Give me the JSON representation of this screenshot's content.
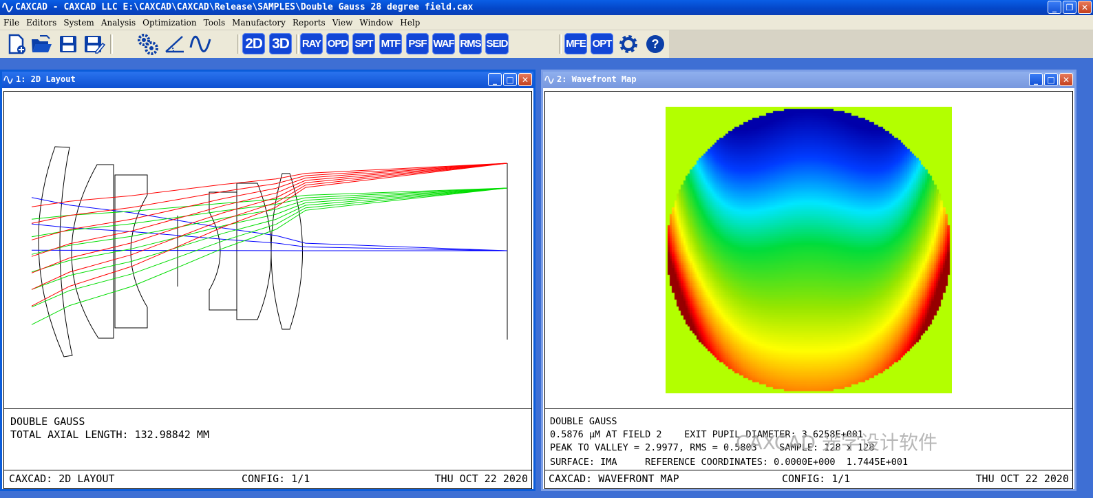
{
  "app": {
    "title": "CAXCAD - CAXCAD LLC E:\\CAXCAD\\CAXCAD\\Release\\SAMPLES\\Double Gauss 28 degree field.cax"
  },
  "menu": [
    "File",
    "Editors",
    "System",
    "Analysis",
    "Optimization",
    "Tools",
    "Manufactory",
    "Reports",
    "View",
    "Window",
    "Help"
  ],
  "toolbar": {
    "file_icons": [
      "new-file-icon",
      "open-folder-icon",
      "save-icon",
      "save-as-icon"
    ],
    "tool_icons": [
      "system-gears-icon",
      "angle-icon",
      "wave-icon"
    ],
    "view_buttons": [
      "2D",
      "3D"
    ],
    "analysis_buttons": [
      "RAY",
      "OPD",
      "SPT",
      "MTF",
      "PSF",
      "WAF",
      "RMS",
      "SEID"
    ],
    "opt_buttons": [
      "MFE",
      "OPT"
    ],
    "extra_icons": [
      "settings-gear-icon",
      "help-icon"
    ]
  },
  "window1": {
    "title": "1: 2D Layout",
    "line1": "DOUBLE GAUSS",
    "line2": "TOTAL AXIAL LENGTH: 132.98842 MM",
    "status_left": "CAXCAD: 2D LAYOUT",
    "status_mid": "CONFIG: 1/1",
    "status_right": "THU OCT 22 2020",
    "ray_colors": [
      "#0000ff",
      "#00dd00",
      "#ff0000"
    ]
  },
  "window2": {
    "title": "2: Wavefront Map",
    "line1": "DOUBLE GAUSS",
    "line2": "0.5876 µM AT FIELD 2    EXIT PUPIL DIAMETER: 3.6258E+001",
    "line3": "PEAK TO VALLEY = 2.9977, RMS = 0.5803    SAMPLE: 128 x 128",
    "line4": "SURFACE: IMA     REFERENCE COORDINATES: 0.0000E+000  1.7445E+001",
    "status_left": "CAXCAD: WAVEFRONT MAP",
    "status_mid": "CONFIG: 1/1",
    "status_right": "THU OCT 22 2020",
    "background_color": "#b3ff00"
  },
  "watermark": "CAXCAD 光学设计软件"
}
